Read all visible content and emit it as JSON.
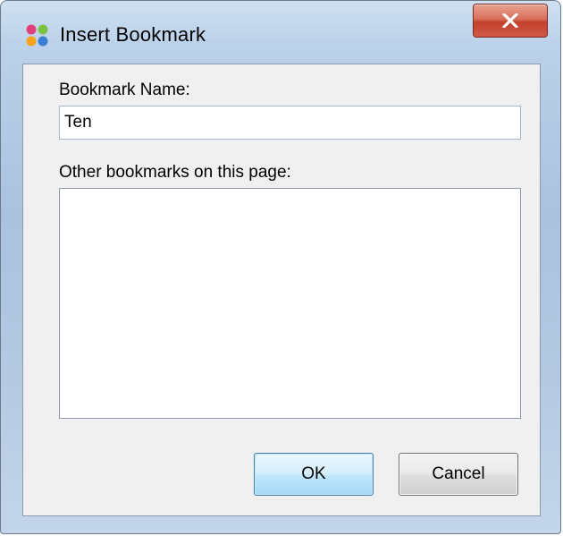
{
  "window": {
    "title": "Insert Bookmark",
    "app_icon": "multicolor-dots-icon",
    "close_icon": "close-icon",
    "close_button_color": "#c7432d"
  },
  "form": {
    "name_label": "Bookmark Name:",
    "name_value": "Ten",
    "other_label": "Other bookmarks on this page:",
    "other_bookmarks": []
  },
  "buttons": {
    "ok_label": "OK",
    "cancel_label": "Cancel"
  }
}
